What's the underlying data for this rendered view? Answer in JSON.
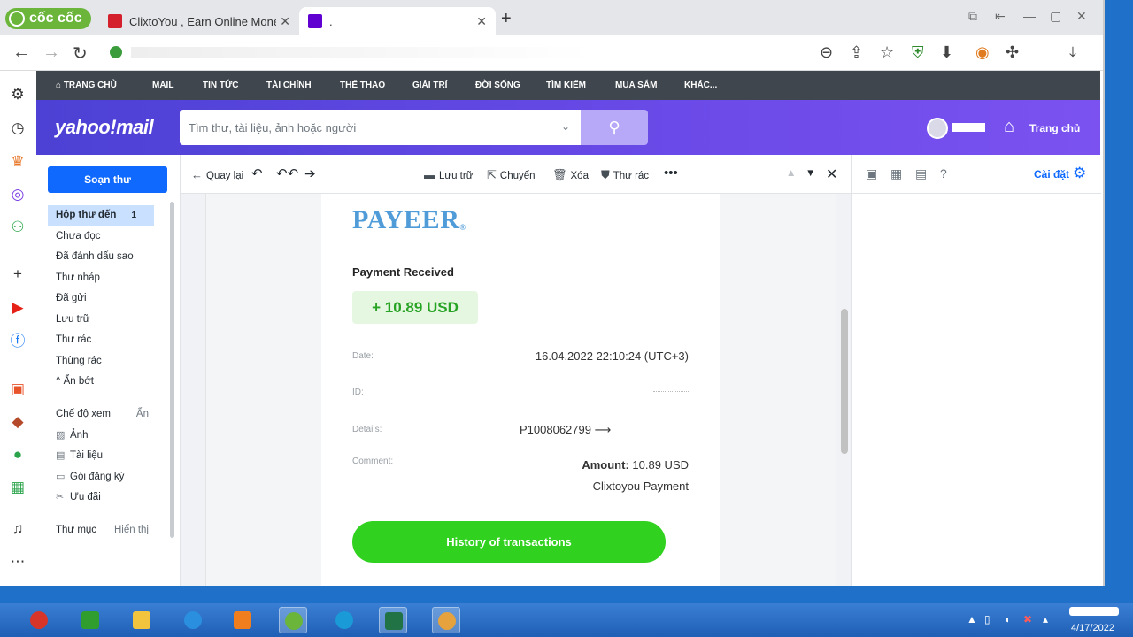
{
  "browser": {
    "brand": "cốc cốc",
    "tabs": [
      {
        "title": "ClixtoYou , Earn Online Money"
      },
      {
        "title": "."
      }
    ]
  },
  "yahoo_nav": [
    "TRANG CHỦ",
    "MAIL",
    "TIN TỨC",
    "TÀI CHÍNH",
    "THỂ THAO",
    "GIẢI TRÍ",
    "ĐỜI SỐNG",
    "TÌM KIẾM",
    "MUA SẮM",
    "KHÁC..."
  ],
  "header": {
    "logo": "yahoo!mail",
    "search_placeholder": "Tìm thư, tài liệu, ảnh hoặc người",
    "home_label": "Trang chủ"
  },
  "sidebar": {
    "compose": "Soạn thư",
    "folders": [
      {
        "label": "Hộp thư đến",
        "count": "1"
      },
      {
        "label": "Chưa đọc"
      },
      {
        "label": "Đã đánh dấu sao"
      },
      {
        "label": "Thư nháp"
      },
      {
        "label": "Đã gửi"
      },
      {
        "label": "Lưu trữ"
      },
      {
        "label": "Thư rác"
      },
      {
        "label": "Thùng rác"
      },
      {
        "label": "^ Ẩn bớt"
      }
    ],
    "view_header": "Chế độ xem",
    "view_toggle": "Ẩn",
    "views": [
      {
        "label": "Ảnh"
      },
      {
        "label": "Tài liệu"
      },
      {
        "label": "Gói đăng ký"
      },
      {
        "label": "Ưu đãi"
      }
    ],
    "folders_header": "Thư mục",
    "folders_toggle": "Hiển thị"
  },
  "message_toolbar": {
    "back": "Quay lại",
    "archive": "Lưu trữ",
    "move": "Chuyển",
    "delete": "Xóa",
    "spam": "Thư rác"
  },
  "email": {
    "brand": "PAYEER",
    "brand_mark": "®",
    "heading": "Payment Received",
    "amount": "+ 10.89 USD",
    "date_label": "Date:",
    "date_value": "16.04.2022 22:10:24 (UTC+3)",
    "id_label": "ID:",
    "details_label": "Details:",
    "details_value": "P1008062799 ⟶",
    "comment_label": "Comment:",
    "amount_label": "Amount:",
    "amount_value": "10.89 USD",
    "comment_value": "Clixtoyou Payment",
    "history_button": "History of transactions"
  },
  "right_pane": {
    "settings_label": "Cài đặt"
  },
  "taskbar": {
    "date": "4/17/2022"
  },
  "colors": {
    "yahoo_purple": "#6001d2",
    "compose_blue": "#0f69ff",
    "payeer_blue": "#4f9cd8",
    "green_button": "#30d11f",
    "amount_green": "#27a325"
  }
}
